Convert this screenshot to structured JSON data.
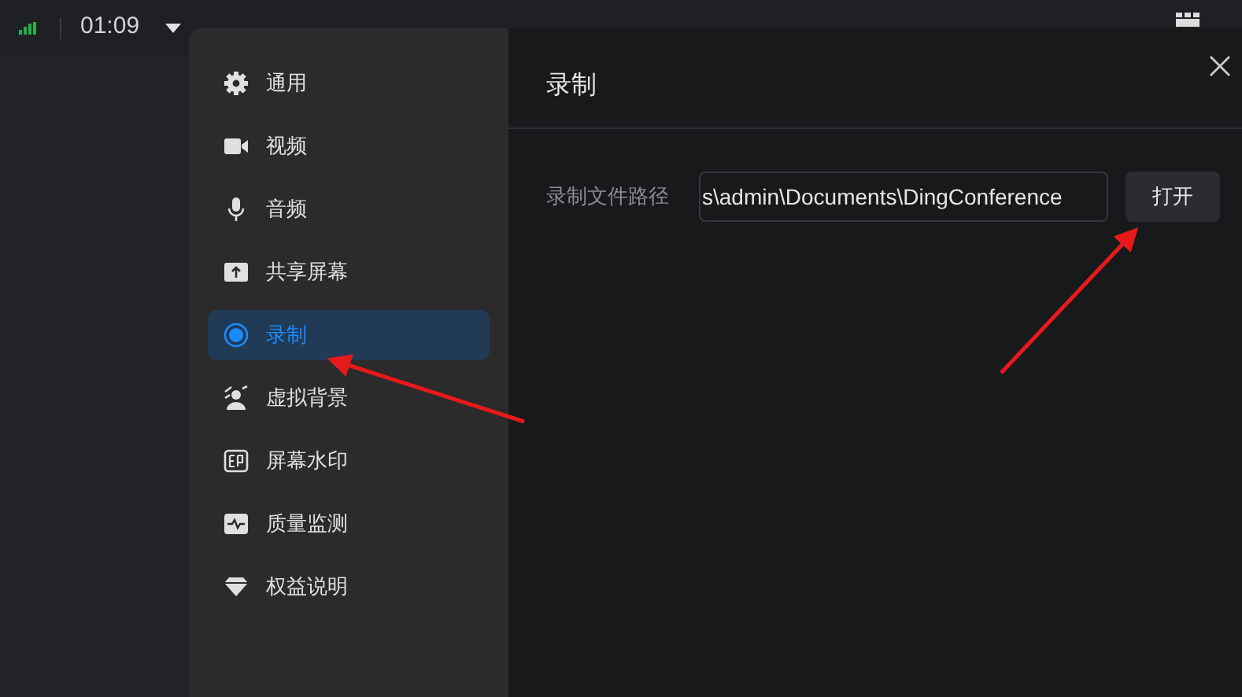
{
  "top_bar": {
    "time": "01:09"
  },
  "sidebar": {
    "items": [
      {
        "label": "通用",
        "selected": false
      },
      {
        "label": "视频",
        "selected": false
      },
      {
        "label": "音频",
        "selected": false
      },
      {
        "label": "共享屏幕",
        "selected": false
      },
      {
        "label": "录制",
        "selected": true
      },
      {
        "label": "虚拟背景",
        "selected": false
      },
      {
        "label": "屏幕水印",
        "selected": false
      },
      {
        "label": "质量监测",
        "selected": false
      },
      {
        "label": "权益说明",
        "selected": false
      }
    ]
  },
  "content": {
    "title": "录制",
    "path_label": "录制文件路径",
    "path_value": "s\\admin\\Documents\\DingConference",
    "open_button": "打开"
  }
}
